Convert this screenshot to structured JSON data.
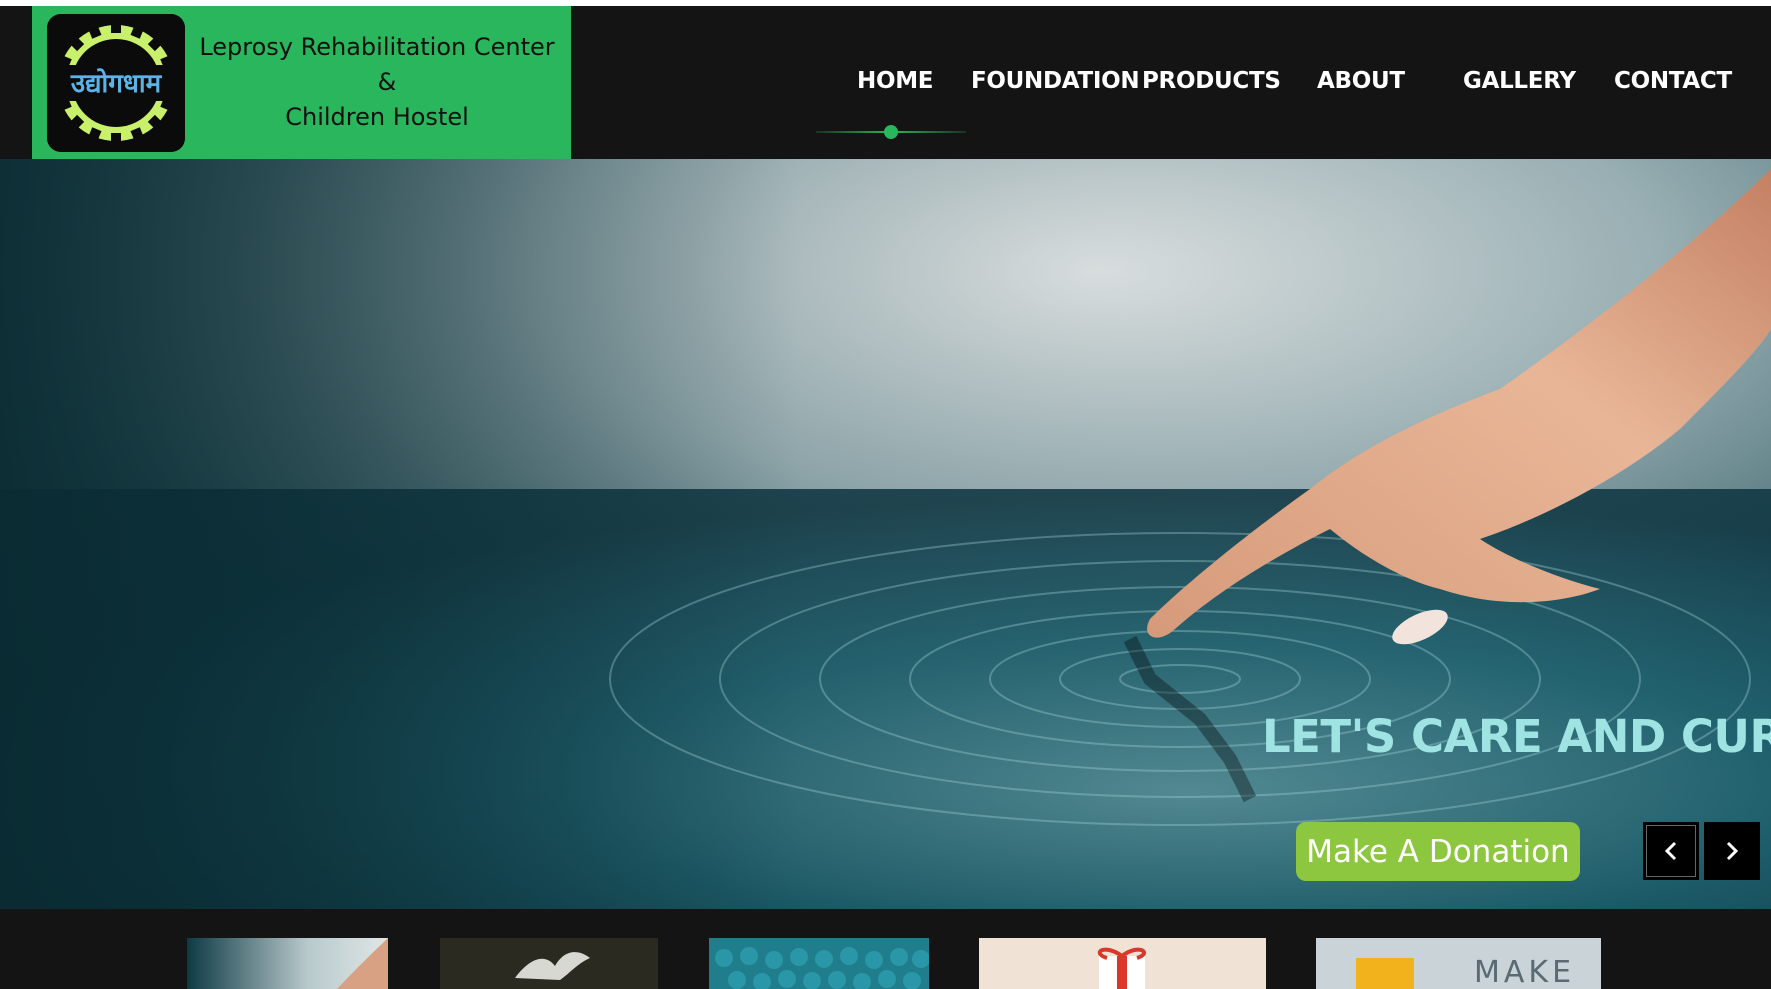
{
  "brand": {
    "logo_text": "उद्योगधाम",
    "line1": "Leprosy Rehabilitation Center",
    "line2": "&",
    "line3": "Children Hostel"
  },
  "nav": {
    "items": [
      {
        "label": "HOME",
        "active": true
      },
      {
        "label": "FOUNDATION",
        "active": false
      },
      {
        "label": "PRODUCTS",
        "active": false
      },
      {
        "label": "ABOUT",
        "active": false
      },
      {
        "label": "GALLERY",
        "active": false
      },
      {
        "label": "CONTACT",
        "active": false
      }
    ]
  },
  "hero": {
    "tagline": "LET'S CARE AND CURE",
    "donate_label": "Make A Donation",
    "prev_icon": "chevron-left-icon",
    "next_icon": "chevron-right-icon"
  },
  "thumbnails": {
    "items": [
      {
        "name": "water-touch-thumb"
      },
      {
        "name": "dove-thumb"
      },
      {
        "name": "crowd-thumb"
      },
      {
        "name": "gift-thumb"
      },
      {
        "name": "make-sign-thumb",
        "text": "MAKE"
      }
    ]
  },
  "colors": {
    "brand_green": "#2ab65c",
    "donate_green": "#8dc63f",
    "tagline": "#9fe4e3",
    "header_bg": "#141414"
  }
}
